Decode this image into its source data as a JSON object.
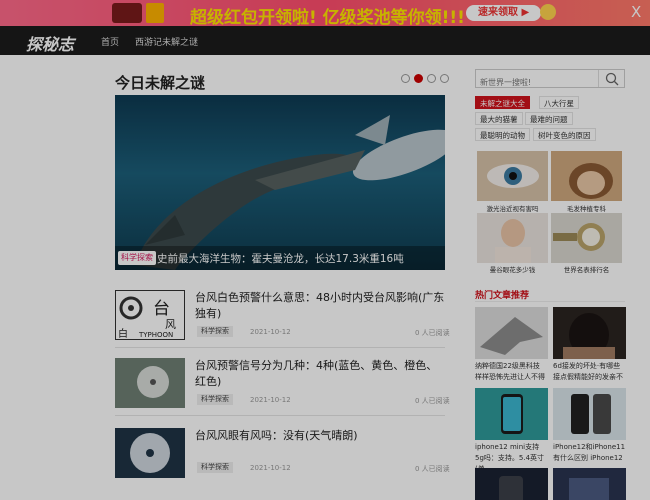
{
  "promo": {
    "text": "超级红包开领啦! 亿级奖池等你领!!!",
    "button": "速来领取 ▶",
    "close": "X"
  },
  "header": {
    "logo": "探秘志",
    "nav": [
      "首页",
      "西游记未解之谜"
    ]
  },
  "main": {
    "section_title": "今日未解之谜",
    "hero": {
      "tag": "科学探索",
      "title": "史前最大海洋生物：霍夫曼沧龙，长达17.3米重16吨"
    },
    "articles": [
      {
        "title": "台风白色预警什么意思：48小时内受台风影响(广东独有)",
        "tag": "科学探索",
        "date": "2021-10-12",
        "reads": "0 人已阅读",
        "thumb_text": {
          "cn1": "台",
          "cn2": "风",
          "cn3": "白",
          "en": "TYPHOON"
        }
      },
      {
        "title": "台风预警信号分为几种：4种(蓝色、黄色、橙色、红色)",
        "tag": "科学探索",
        "date": "2021-10-12",
        "reads": "0 人已阅读"
      },
      {
        "title": "台风风眼有风吗：没有(天气晴朗)",
        "tag": "科学探索",
        "date": "2021-10-12",
        "reads": "0 人已阅读"
      }
    ]
  },
  "sidebar": {
    "search_placeholder": "新世界一搜啦!",
    "tags": [
      [
        "未解之谜大全",
        "八大行星"
      ],
      [
        "最大的猫薯",
        "最难的问题"
      ],
      [
        "最聪明的动物",
        "树叶变色的原因"
      ]
    ],
    "gallery": [
      "激光治近视有害吗",
      "毛发种植专科",
      "曼谷眼花多少钱",
      "世界名表排行名"
    ],
    "hot_title": "热门文章推荐",
    "hot": [
      "纳粹德国22级黑科技 样样恐怖先进让人不得",
      "6d接发的坏处·有哪些接点假精能好的发亲不",
      "iphone12 mini支持5g吗：支持。5.4英寸(单",
      "iPhone12和iPhone11有什么区别 iPhone12"
    ]
  }
}
